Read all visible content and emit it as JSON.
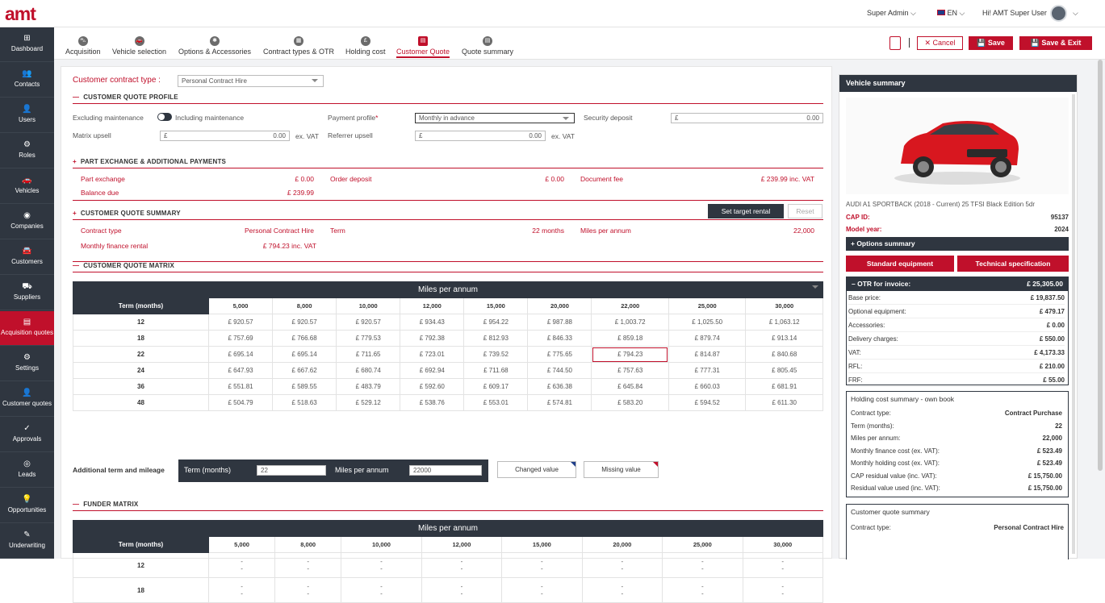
{
  "brand": {
    "logo": "amt"
  },
  "topbar": {
    "role": "Super Admin",
    "lang": "EN",
    "greeting": "Hi! AMT Super User"
  },
  "sidebar": [
    {
      "label": "Dashboard",
      "icon": "dashboard-icon",
      "glyph": "⊞"
    },
    {
      "label": "Contacts",
      "icon": "contacts-icon",
      "glyph": "👥"
    },
    {
      "label": "Users",
      "icon": "users-icon",
      "glyph": "👤"
    },
    {
      "label": "Roles",
      "icon": "roles-icon",
      "glyph": "⚙"
    },
    {
      "label": "Vehicles",
      "icon": "vehicles-icon",
      "glyph": "🚗"
    },
    {
      "label": "Companies",
      "icon": "companies-icon",
      "glyph": "◉"
    },
    {
      "label": "Customers",
      "icon": "customers-icon",
      "glyph": "🚘"
    },
    {
      "label": "Suppliers",
      "icon": "suppliers-icon",
      "glyph": "⛟"
    },
    {
      "label": "Acquisition quotes",
      "icon": "acquisition-quotes-icon",
      "glyph": "▤"
    },
    {
      "label": "Settings",
      "icon": "settings-icon",
      "glyph": "⚙"
    },
    {
      "label": "Customer quotes",
      "icon": "customer-quotes-icon",
      "glyph": "👤"
    },
    {
      "label": "Approvals",
      "icon": "approvals-icon",
      "glyph": "✓"
    },
    {
      "label": "Leads",
      "icon": "leads-icon",
      "glyph": "◎"
    },
    {
      "label": "Opportunities",
      "icon": "opportunities-icon",
      "glyph": "💡"
    },
    {
      "label": "Underwriting",
      "icon": "underwriting-icon",
      "glyph": "✎"
    }
  ],
  "tabs": [
    {
      "label": "Acquisition",
      "icon": "acquisition-icon",
      "glyph": "⛍"
    },
    {
      "label": "Vehicle selection",
      "icon": "vehicle-selection-icon",
      "glyph": "🚗"
    },
    {
      "label": "Options & Accessories",
      "icon": "options-icon",
      "glyph": "✱"
    },
    {
      "label": "Contract types & OTR",
      "icon": "contract-types-icon",
      "glyph": "▦"
    },
    {
      "label": "Holding cost",
      "icon": "holding-cost-icon",
      "glyph": "£"
    },
    {
      "label": "Customer Quote",
      "icon": "customer-quote-icon",
      "glyph": "▤"
    },
    {
      "label": "Quote summary",
      "icon": "quote-summary-icon",
      "glyph": "▤"
    }
  ],
  "actions": {
    "cancel": "✕ Cancel",
    "save": "💾 Save",
    "save_exit": "💾 Save & Exit"
  },
  "form": {
    "contract_type_label": "Customer contract type :",
    "contract_type": "Personal Contract Hire",
    "profile_title": "CUSTOMER QUOTE PROFILE",
    "excl_maint": "Excluding maintenance",
    "incl_maint": "Including maintenance",
    "payment_profile_label": "Payment profile",
    "payment_profile": "Monthly in advance",
    "security_deposit_label": "Security deposit",
    "security_deposit": "0.00",
    "matrix_upsell_label": "Matrix upsell",
    "matrix_upsell": "0.00",
    "ex_vat": "ex. VAT",
    "referrer_upsell_label": "Referrer upsell",
    "referrer_upsell": "0.00",
    "currency": "£"
  },
  "part_exchange": {
    "title": "PART EXCHANGE & ADDITIONAL PAYMENTS",
    "part_exchange_label": "Part exchange",
    "part_exchange": "£ 0.00",
    "order_deposit_label": "Order deposit",
    "order_deposit": "£ 0.00",
    "document_fee_label": "Document fee",
    "document_fee": "£ 239.99 inc. VAT",
    "balance_due_label": "Balance due",
    "balance_due": "£ 239.99"
  },
  "summary": {
    "title": "CUSTOMER QUOTE SUMMARY",
    "set_target": "Set target rental",
    "reset": "Reset",
    "contract_type_label": "Contract type",
    "contract_type": "Personal Contract Hire",
    "term_label": "Term",
    "term": "22 months",
    "miles_label": "Miles per annum",
    "miles": "22,000",
    "rental_label": "Monthly finance rental",
    "rental": "£ 794.23 inc. VAT"
  },
  "matrix": {
    "title": "CUSTOMER QUOTE MATRIX",
    "header": "Miles per annum",
    "row_header": "Term (months)",
    "miles": [
      "5,000",
      "8,000",
      "10,000",
      "12,000",
      "15,000",
      "20,000",
      "22,000",
      "25,000",
      "30,000"
    ],
    "rows": [
      {
        "term": "12",
        "values": [
          "£ 920.57",
          "£ 920.57",
          "£ 920.57",
          "£ 934.43",
          "£ 954.22",
          "£ 987.88",
          "£ 1,003.72",
          "£ 1,025.50",
          "£ 1,063.12"
        ]
      },
      {
        "term": "18",
        "values": [
          "£ 757.69",
          "£ 766.68",
          "£ 779.53",
          "£ 792.38",
          "£ 812.93",
          "£ 846.33",
          "£ 859.18",
          "£ 879.74",
          "£ 913.14"
        ]
      },
      {
        "term": "22",
        "values": [
          "£ 695.14",
          "£ 695.14",
          "£ 711.65",
          "£ 723.01",
          "£ 739.52",
          "£ 775.65",
          "£ 794.23",
          "£ 814.87",
          "£ 840.68"
        ]
      },
      {
        "term": "24",
        "values": [
          "£ 647.93",
          "£ 667.62",
          "£ 680.74",
          "£ 692.94",
          "£ 711.68",
          "£ 744.50",
          "£ 757.63",
          "£ 777.31",
          "£ 805.45"
        ]
      },
      {
        "term": "36",
        "values": [
          "£ 551.81",
          "£ 589.55",
          "£ 483.79",
          "£ 592.60",
          "£ 609.17",
          "£ 636.38",
          "£ 645.84",
          "£ 660.03",
          "£ 681.91"
        ]
      },
      {
        "term": "48",
        "values": [
          "£ 504.79",
          "£ 518.63",
          "£ 529.12",
          "£ 538.76",
          "£ 553.01",
          "£ 574.81",
          "£ 583.20",
          "£ 594.52",
          "£ 611.30"
        ]
      }
    ],
    "selected": {
      "row": 2,
      "col": 6
    }
  },
  "additional": {
    "label": "Additional term and mileage",
    "term_label": "Term (months)",
    "term": "22",
    "miles_label": "Miles per annum",
    "miles": "22000",
    "changed": "Changed value",
    "missing": "Missing value"
  },
  "funder": {
    "title": "FUNDER MATRIX",
    "header": "Miles per annum",
    "row_header": "Term (months)",
    "miles": [
      "5,000",
      "8,000",
      "10,000",
      "12,000",
      "15,000",
      "20,000",
      "25,000",
      "30,000"
    ],
    "terms": [
      "12",
      "18"
    ],
    "dash": "-"
  },
  "vehicle": {
    "title": "Vehicle summary",
    "name": "AUDI A1 SPORTBACK (2018 - Current) 25 TFSI Black Edition 5dr",
    "cap_id_label": "CAP ID:",
    "cap_id": "95137",
    "model_year_label": "Model year:",
    "model_year": "2024",
    "options_summary": "+ Options summary",
    "std_equipment": "Standard equipment",
    "tech_spec": "Technical specification",
    "otr_label": "– OTR for invoice:",
    "otr": "£ 25,305.00",
    "price_rows": [
      {
        "label": "Base price:",
        "value": "£ 19,837.50"
      },
      {
        "label": "Optional equipment:",
        "value": "£ 479.17"
      },
      {
        "label": "Accessories:",
        "value": "£ 0.00"
      },
      {
        "label": "Delivery charges:",
        "value": "£ 550.00"
      },
      {
        "label": "VAT:",
        "value": "£ 4,173.33"
      },
      {
        "label": "RFL:",
        "value": "£ 210.00"
      },
      {
        "label": "FRF:",
        "value": "£ 55.00"
      }
    ],
    "holding_title": "Holding cost summary - own book",
    "holding_rows": [
      {
        "label": "Contract type:",
        "value": "Contract Purchase"
      },
      {
        "label": "Term (months):",
        "value": "22"
      },
      {
        "label": "Miles per annum:",
        "value": "22,000"
      },
      {
        "label": "Monthly finance cost (ex. VAT):",
        "value": "£ 523.49"
      },
      {
        "label": "Monthly holding cost (ex. VAT):",
        "value": "£ 523.49"
      },
      {
        "label": "CAP residual value (inc. VAT):",
        "value": "£ 15,750.00"
      },
      {
        "label": "Residual value used (inc. VAT):",
        "value": "£ 15,750.00"
      }
    ],
    "cq_title": "Customer quote summary",
    "cq_contract_label": "Contract type:",
    "cq_contract": "Personal Contract Hire"
  },
  "colors": {
    "accent": "#c0102b",
    "dark": "#2f3640"
  }
}
